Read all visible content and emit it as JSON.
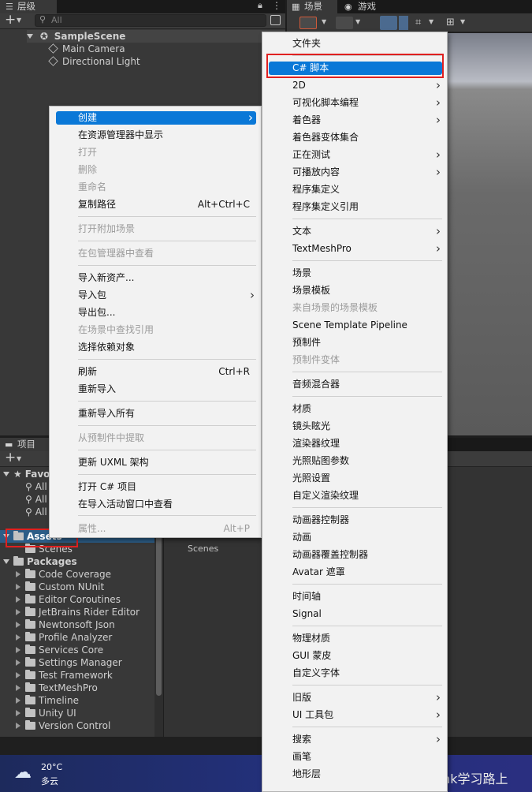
{
  "hierarchy": {
    "tab_label": "层级",
    "search_placeholder": "All",
    "scene_name": "SampleScene",
    "objects": [
      "Main Camera",
      "Directional Light"
    ]
  },
  "scene_tabs": {
    "scene_label": "场景",
    "game_label": "游戏"
  },
  "project": {
    "tab_label": "项目",
    "favorites_label": "Favo",
    "favorites": [
      "All",
      "All",
      "All"
    ],
    "assets_label": "Assets",
    "assets_children": [
      "Scenes"
    ],
    "packages_label": "Packages",
    "packages": [
      "Code Coverage",
      "Custom NUnit",
      "Editor Coroutines",
      "JetBrains Rider Editor",
      "Newtonsoft Json",
      "Profile Analyzer",
      "Services Core",
      "Settings Manager",
      "Test Framework",
      "TextMeshPro",
      "Timeline",
      "Unity UI",
      "Version Control"
    ],
    "right_pane_item": "Scenes"
  },
  "context_menu": {
    "items": [
      {
        "label": "创建",
        "submenu": true,
        "selected": true
      },
      {
        "label": "在资源管理器中显示"
      },
      {
        "label": "打开",
        "disabled": true
      },
      {
        "label": "删除",
        "disabled": true
      },
      {
        "label": "重命名",
        "disabled": true
      },
      {
        "label": "复制路径",
        "shortcut": "Alt+Ctrl+C"
      },
      {
        "label": "打开附加场景",
        "disabled": true
      },
      {
        "label": "在包管理器中查看",
        "disabled": true
      },
      {
        "label": "导入新资产..."
      },
      {
        "label": "导入包",
        "submenu": true
      },
      {
        "label": "导出包..."
      },
      {
        "label": "在场景中查找引用",
        "disabled": true
      },
      {
        "label": "选择依赖对象"
      },
      {
        "label": "刷新",
        "shortcut": "Ctrl+R"
      },
      {
        "label": "重新导入"
      },
      {
        "label": "重新导入所有"
      },
      {
        "label": "从预制件中提取",
        "disabled": true
      },
      {
        "label": "更新 UXML 架构"
      },
      {
        "label": "打开 C# 项目"
      },
      {
        "label": "在导入活动窗口中查看"
      },
      {
        "label": "属性...",
        "shortcut": "Alt+P",
        "disabled": true
      }
    ]
  },
  "create_menu": {
    "items": [
      {
        "label": "文件夹"
      },
      {
        "label": "C# 脚本",
        "selected": true
      },
      {
        "label": "2D",
        "submenu": true
      },
      {
        "label": "可视化脚本编程",
        "submenu": true
      },
      {
        "label": "着色器",
        "submenu": true
      },
      {
        "label": "着色器变体集合"
      },
      {
        "label": "正在测试",
        "submenu": true
      },
      {
        "label": "可播放内容",
        "submenu": true
      },
      {
        "label": "程序集定义"
      },
      {
        "label": "程序集定义引用"
      },
      {
        "label": "文本",
        "submenu": true
      },
      {
        "label": "TextMeshPro",
        "submenu": true
      },
      {
        "label": "场景"
      },
      {
        "label": "场景模板"
      },
      {
        "label": "来自场景的场景模板",
        "disabled": true
      },
      {
        "label": "Scene Template Pipeline"
      },
      {
        "label": "预制件"
      },
      {
        "label": "预制件变体",
        "disabled": true
      },
      {
        "label": "音频混合器"
      },
      {
        "label": "材质"
      },
      {
        "label": "镜头眩光"
      },
      {
        "label": "渲染器纹理"
      },
      {
        "label": "光照贴图参数"
      },
      {
        "label": "光照设置"
      },
      {
        "label": "自定义渲染纹理"
      },
      {
        "label": "动画器控制器"
      },
      {
        "label": "动画"
      },
      {
        "label": "动画器覆盖控制器"
      },
      {
        "label": "Avatar 遮罩"
      },
      {
        "label": "时间轴"
      },
      {
        "label": "Signal"
      },
      {
        "label": "物理材质"
      },
      {
        "label": "GUI 蒙皮"
      },
      {
        "label": "自定义字体"
      },
      {
        "label": "旧版",
        "submenu": true
      },
      {
        "label": "UI 工具包",
        "submenu": true
      },
      {
        "label": "搜索",
        "submenu": true
      },
      {
        "label": "画笔"
      },
      {
        "label": "地形层"
      }
    ]
  },
  "taskbar": {
    "temperature": "20°C",
    "weather": "多云"
  },
  "watermark": "CSDN @Frank学习路上",
  "colors": {
    "selection": "#0a78d7",
    "highlight_box": "#e02020",
    "unity_select": "#2c5d87"
  }
}
